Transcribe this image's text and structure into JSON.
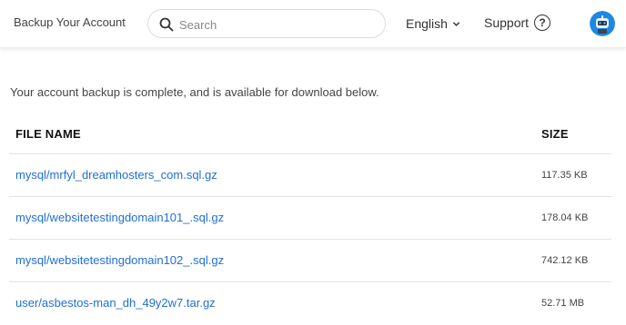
{
  "header": {
    "title": "Backup Your Account",
    "search_placeholder": "Search",
    "language": "English",
    "support_label": "Support",
    "help_symbol": "?"
  },
  "main": {
    "message": "Your account backup is complete, and is available for download below.",
    "table": {
      "columns": [
        "FILE NAME",
        "SIZE"
      ],
      "rows": [
        {
          "file": "mysql/mrfyl_dreamhosters_com.sql.gz",
          "size": "117.35 KB"
        },
        {
          "file": "mysql/websitetestingdomain101_.sql.gz",
          "size": "178.04 KB"
        },
        {
          "file": "mysql/websitetestingdomain102_.sql.gz",
          "size": "742.12 KB"
        },
        {
          "file": "user/asbestos-man_dh_49y2w7.tar.gz",
          "size": "52.71 MB"
        }
      ]
    }
  },
  "colors": {
    "link": "#1f6fd6",
    "avatar_bg": "#1e88e5"
  },
  "icons": [
    "search-icon",
    "chevron-down-icon",
    "help-icon",
    "robot-avatar-icon"
  ]
}
